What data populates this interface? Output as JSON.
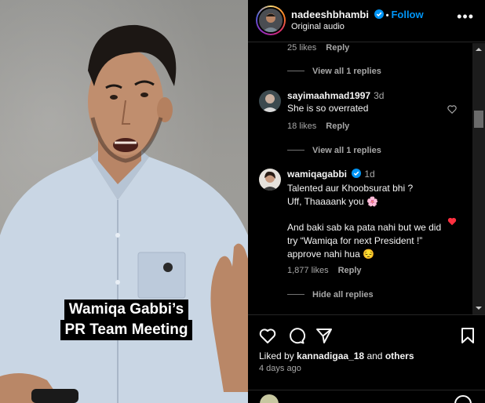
{
  "video": {
    "caption_line1": "Wamiqa Gabbi’s",
    "caption_line2": "PR Team Meeting"
  },
  "header": {
    "username": "nadeeshbhambi",
    "follow_label": "Follow",
    "audio_label": "Original audio",
    "more_icon": "more-horizontal-icon"
  },
  "comments": {
    "top_likes": "25 likes",
    "reply_label": "Reply",
    "view_replies_1": "View all 1 replies",
    "c1": {
      "username": "sayimaahmad1997",
      "time": "3d",
      "text": "She is so overrated",
      "likes": "18 likes"
    },
    "view_replies_2": "View all 1 replies",
    "c2": {
      "username": "wamiqagabbi",
      "time": "1d",
      "text_line1": "Talented aur Khoobsurat bhi ?",
      "text_line2": "Uff, Thaaaank you 🌸",
      "text_line3": "And baki sab ka pata nahi but we did try “Wamiqa for next President !” approve nahi hua 😔",
      "likes": "1,877 likes"
    },
    "hide_replies": "Hide all replies"
  },
  "footer": {
    "liked_prefix": "Liked by",
    "liked_user": "kannadigaa_18",
    "liked_and": "and",
    "liked_others": "others",
    "ago": "4 days ago"
  },
  "colors": {
    "accent": "#0095f6",
    "like_red": "#ff3040",
    "muted": "#a8a8a8"
  }
}
